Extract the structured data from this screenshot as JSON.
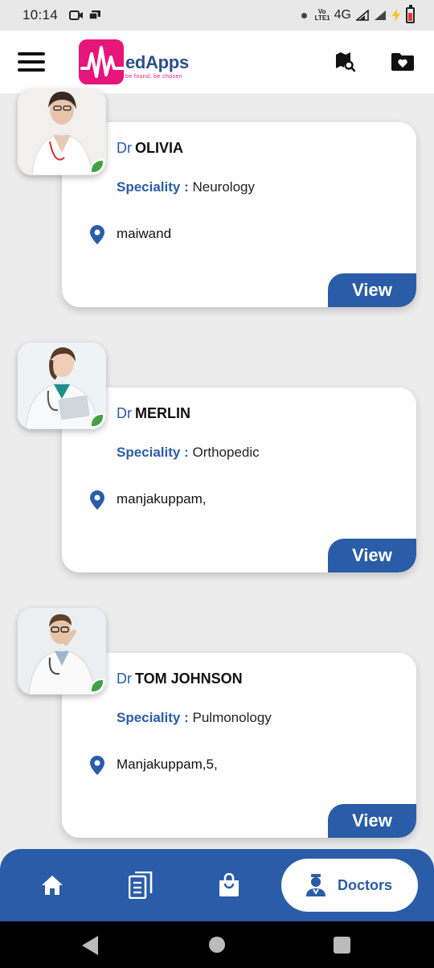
{
  "status_bar": {
    "time": "10:14",
    "network": "4G",
    "volte": "Vo LTE1"
  },
  "header": {
    "logo_name": "edApps",
    "logo_tagline": "be found, be chosen",
    "brand_color": "#e6157a",
    "primary_color": "#2a5ca8"
  },
  "doctors": [
    {
      "prefix": "Dr",
      "name": "OLIVIA",
      "speciality_label": "Speciality :",
      "speciality": "Neurology",
      "location": "maiwand",
      "view_label": "View",
      "online": true
    },
    {
      "prefix": "Dr",
      "name": "MERLIN",
      "speciality_label": "Speciality :",
      "speciality": "Orthopedic",
      "location": "manjakuppam,",
      "view_label": "View",
      "online": true
    },
    {
      "prefix": "Dr",
      "name": "TOM JOHNSON",
      "speciality_label": "Speciality :",
      "speciality": "Pulmonology",
      "location": "Manjakuppam,5,",
      "view_label": "View",
      "online": true
    }
  ],
  "bottom_nav": {
    "items": [
      {
        "icon": "home-icon"
      },
      {
        "icon": "document-icon"
      },
      {
        "icon": "shopping-bag-icon"
      }
    ],
    "active_label": "Doctors",
    "active_icon": "doctor-icon"
  }
}
